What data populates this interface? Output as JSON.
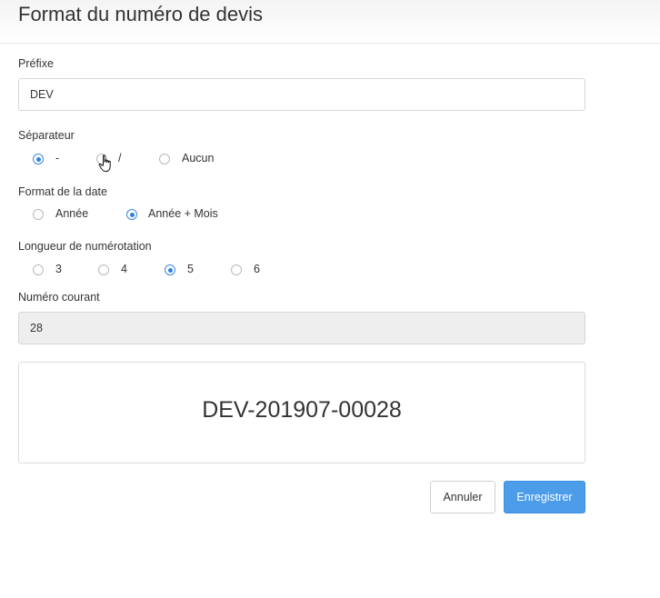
{
  "dialog": {
    "title": "Format du numéro de devis"
  },
  "prefix": {
    "label": "Préfixe",
    "value": "DEV"
  },
  "separator": {
    "label": "Séparateur",
    "options": [
      {
        "label": "-",
        "checked": true
      },
      {
        "label": "/",
        "checked": false
      },
      {
        "label": "Aucun",
        "checked": false
      }
    ]
  },
  "date_format": {
    "label": "Format de la date",
    "options": [
      {
        "label": "Année",
        "checked": false
      },
      {
        "label": "Année + Mois",
        "checked": true
      }
    ]
  },
  "number_length": {
    "label": "Longueur de numérotation",
    "options": [
      {
        "label": "3",
        "checked": false
      },
      {
        "label": "4",
        "checked": false
      },
      {
        "label": "5",
        "checked": true
      },
      {
        "label": "6",
        "checked": false
      }
    ]
  },
  "current_number": {
    "label": "Numéro courant",
    "value": "28"
  },
  "preview": {
    "value": "DEV-201907-00028"
  },
  "actions": {
    "cancel_label": "Annuler",
    "save_label": "Enregistrer"
  },
  "colors": {
    "accent": "#4c9ce9",
    "radio_checked": "#2f7fe0"
  },
  "icons": {
    "cursor": "hand-pointer-icon"
  }
}
